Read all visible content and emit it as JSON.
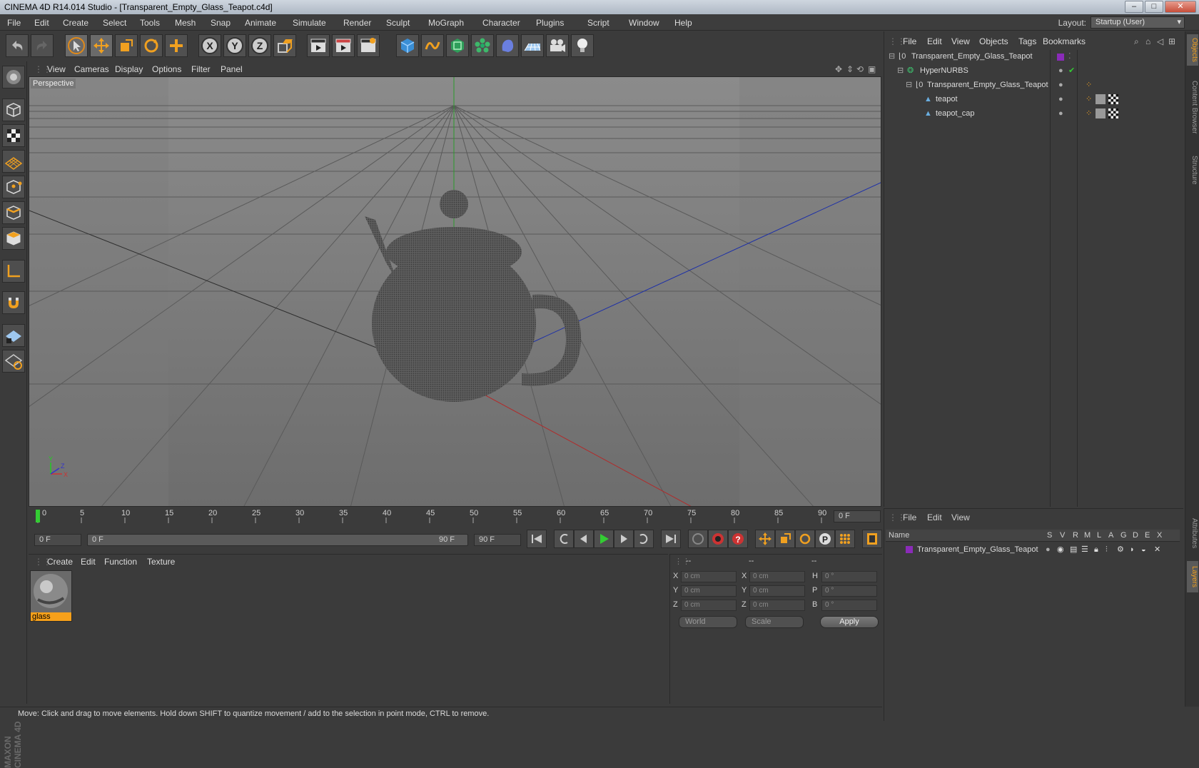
{
  "window": {
    "title": "CINEMA 4D R14.014 Studio - [Transparent_Empty_Glass_Teapot.c4d]",
    "minimize": "–",
    "maximize": "□",
    "close": "✕"
  },
  "menubar": {
    "items": [
      "File",
      "Edit",
      "Create",
      "Select",
      "Tools",
      "Mesh",
      "Snap",
      "Animate",
      "Simulate",
      "Render",
      "Sculpt",
      "MoGraph",
      "Character",
      "Plugins",
      "Script",
      "Window",
      "Help"
    ],
    "layout_label": "Layout:",
    "layout_value": "Startup (User)"
  },
  "viewport": {
    "menu": [
      "View",
      "Cameras",
      "Display",
      "Options",
      "Filter",
      "Panel"
    ],
    "label": "Perspective",
    "axis_x": "X",
    "axis_y": "Y",
    "axis_z": "Z"
  },
  "timeline": {
    "ticks": [
      "0",
      "5",
      "10",
      "15",
      "20",
      "25",
      "30",
      "35",
      "40",
      "45",
      "50",
      "55",
      "60",
      "65",
      "70",
      "75",
      "80",
      "85",
      "90"
    ],
    "current_frame": "0 F"
  },
  "playbar": {
    "start_field": "0 F",
    "range_start": "0 F",
    "range_end": "90 F",
    "end_field": "90 F"
  },
  "materials": {
    "menu": [
      "Create",
      "Edit",
      "Function",
      "Texture"
    ],
    "items": [
      {
        "name": "glass"
      }
    ]
  },
  "coordinates": {
    "head1": "--",
    "head2": "--",
    "head3": "--",
    "rows": [
      {
        "a": "X",
        "av": "0 cm",
        "b": "X",
        "bv": "0 cm",
        "c": "H",
        "cv": "0 °"
      },
      {
        "a": "Y",
        "av": "0 cm",
        "b": "Y",
        "bv": "0 cm",
        "c": "P",
        "cv": "0 °"
      },
      {
        "a": "Z",
        "av": "0 cm",
        "b": "Z",
        "bv": "0 cm",
        "c": "B",
        "cv": "0 °"
      }
    ],
    "mode1": "World",
    "mode2": "Scale",
    "apply": "Apply"
  },
  "objects": {
    "menu": [
      "File",
      "Edit",
      "View",
      "Objects",
      "Tags",
      "Bookmarks"
    ],
    "tree": [
      {
        "name": "Transparent_Empty_Glass_Teapot"
      },
      {
        "name": "HyperNURBS"
      },
      {
        "name": "Transparent_Empty_Glass_Teapot"
      },
      {
        "name": "teapot"
      },
      {
        "name": "teapot_cap"
      }
    ]
  },
  "layers": {
    "menu": [
      "File",
      "Edit",
      "View"
    ],
    "columns": [
      "Name",
      "S",
      "V",
      "R",
      "M",
      "L",
      "A",
      "G",
      "D",
      "E",
      "X"
    ],
    "rows": [
      {
        "name": "Transparent_Empty_Glass_Teapot"
      }
    ]
  },
  "sidetabs": [
    "Objects",
    "Content Browser",
    "Structure",
    "Attributes",
    "Layers"
  ],
  "status": "Move: Click and drag to move elements. Hold down SHIFT to quantize movement / add to the selection in point mode, CTRL to remove.",
  "brand": "MAXON CINEMA 4D",
  "colors": {
    "accent": "#f6a01a",
    "layer_color": "#8a2bb8"
  }
}
